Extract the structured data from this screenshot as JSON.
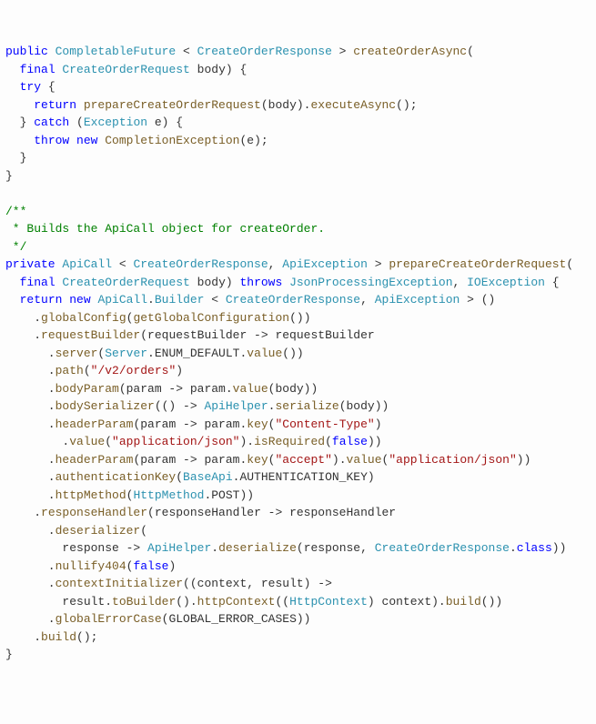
{
  "code": {
    "tokens": [
      {
        "t": "public ",
        "c": "kw"
      },
      {
        "t": "CompletableFuture",
        "c": "type"
      },
      {
        "t": " < ",
        "c": "pl"
      },
      {
        "t": "CreateOrderResponse",
        "c": "type"
      },
      {
        "t": " > ",
        "c": "pl"
      },
      {
        "t": "createOrderAsync",
        "c": "method"
      },
      {
        "t": "(",
        "c": "pl"
      },
      {
        "t": "\n",
        "c": "pl"
      },
      {
        "t": "  ",
        "c": "pl"
      },
      {
        "t": "final ",
        "c": "kw"
      },
      {
        "t": "CreateOrderRequest",
        "c": "type"
      },
      {
        "t": " body) {",
        "c": "pl"
      },
      {
        "t": "\n",
        "c": "pl"
      },
      {
        "t": "  ",
        "c": "pl"
      },
      {
        "t": "try",
        "c": "kw"
      },
      {
        "t": " {",
        "c": "pl"
      },
      {
        "t": "\n",
        "c": "pl"
      },
      {
        "t": "    ",
        "c": "pl"
      },
      {
        "t": "return ",
        "c": "kw"
      },
      {
        "t": "prepareCreateOrderRequest",
        "c": "method"
      },
      {
        "t": "(body).",
        "c": "pl"
      },
      {
        "t": "executeAsync",
        "c": "method"
      },
      {
        "t": "();",
        "c": "pl"
      },
      {
        "t": "\n",
        "c": "pl"
      },
      {
        "t": "  } ",
        "c": "pl"
      },
      {
        "t": "catch",
        "c": "kw"
      },
      {
        "t": " (",
        "c": "pl"
      },
      {
        "t": "Exception",
        "c": "type"
      },
      {
        "t": " e) {",
        "c": "pl"
      },
      {
        "t": "\n",
        "c": "pl"
      },
      {
        "t": "    ",
        "c": "pl"
      },
      {
        "t": "throw new ",
        "c": "kw"
      },
      {
        "t": "CompletionException",
        "c": "method"
      },
      {
        "t": "(e);",
        "c": "pl"
      },
      {
        "t": "\n",
        "c": "pl"
      },
      {
        "t": "  }",
        "c": "pl"
      },
      {
        "t": "\n",
        "c": "pl"
      },
      {
        "t": "}",
        "c": "pl"
      },
      {
        "t": "\n",
        "c": "pl"
      },
      {
        "t": "\n",
        "c": "pl"
      },
      {
        "t": "/**",
        "c": "comment"
      },
      {
        "t": "\n",
        "c": "pl"
      },
      {
        "t": " * Builds the ApiCall object for createOrder.",
        "c": "comment"
      },
      {
        "t": "\n",
        "c": "pl"
      },
      {
        "t": " */",
        "c": "comment"
      },
      {
        "t": "\n",
        "c": "pl"
      },
      {
        "t": "private ",
        "c": "kw"
      },
      {
        "t": "ApiCall",
        "c": "type"
      },
      {
        "t": " < ",
        "c": "pl"
      },
      {
        "t": "CreateOrderResponse",
        "c": "type"
      },
      {
        "t": ", ",
        "c": "pl"
      },
      {
        "t": "ApiException",
        "c": "type"
      },
      {
        "t": " > ",
        "c": "pl"
      },
      {
        "t": "prepareCreateOrderRequest",
        "c": "method"
      },
      {
        "t": "(",
        "c": "pl"
      },
      {
        "t": "\n",
        "c": "pl"
      },
      {
        "t": "  ",
        "c": "pl"
      },
      {
        "t": "final ",
        "c": "kw"
      },
      {
        "t": "CreateOrderRequest",
        "c": "type"
      },
      {
        "t": " body) ",
        "c": "pl"
      },
      {
        "t": "throws ",
        "c": "kw"
      },
      {
        "t": "JsonProcessingException",
        "c": "type"
      },
      {
        "t": ", ",
        "c": "pl"
      },
      {
        "t": "IOException",
        "c": "type"
      },
      {
        "t": " {",
        "c": "pl"
      },
      {
        "t": "\n",
        "c": "pl"
      },
      {
        "t": "  ",
        "c": "pl"
      },
      {
        "t": "return new ",
        "c": "kw"
      },
      {
        "t": "ApiCall",
        "c": "type"
      },
      {
        "t": ".",
        "c": "pl"
      },
      {
        "t": "Builder",
        "c": "type"
      },
      {
        "t": " < ",
        "c": "pl"
      },
      {
        "t": "CreateOrderResponse",
        "c": "type"
      },
      {
        "t": ", ",
        "c": "pl"
      },
      {
        "t": "ApiException",
        "c": "type"
      },
      {
        "t": " > ()",
        "c": "pl"
      },
      {
        "t": "\n",
        "c": "pl"
      },
      {
        "t": "    .",
        "c": "pl"
      },
      {
        "t": "globalConfig",
        "c": "method"
      },
      {
        "t": "(",
        "c": "pl"
      },
      {
        "t": "getGlobalConfiguration",
        "c": "method"
      },
      {
        "t": "())",
        "c": "pl"
      },
      {
        "t": "\n",
        "c": "pl"
      },
      {
        "t": "    .",
        "c": "pl"
      },
      {
        "t": "requestBuilder",
        "c": "method"
      },
      {
        "t": "(requestBuilder -> requestBuilder",
        "c": "pl"
      },
      {
        "t": "\n",
        "c": "pl"
      },
      {
        "t": "      .",
        "c": "pl"
      },
      {
        "t": "server",
        "c": "method"
      },
      {
        "t": "(",
        "c": "pl"
      },
      {
        "t": "Server",
        "c": "type"
      },
      {
        "t": ".ENUM_DEFAULT.",
        "c": "pl"
      },
      {
        "t": "value",
        "c": "method"
      },
      {
        "t": "())",
        "c": "pl"
      },
      {
        "t": "\n",
        "c": "pl"
      },
      {
        "t": "      .",
        "c": "pl"
      },
      {
        "t": "path",
        "c": "method"
      },
      {
        "t": "(",
        "c": "pl"
      },
      {
        "t": "\"/v2/orders\"",
        "c": "str"
      },
      {
        "t": ")",
        "c": "pl"
      },
      {
        "t": "\n",
        "c": "pl"
      },
      {
        "t": "      .",
        "c": "pl"
      },
      {
        "t": "bodyParam",
        "c": "method"
      },
      {
        "t": "(param -> param.",
        "c": "pl"
      },
      {
        "t": "value",
        "c": "method"
      },
      {
        "t": "(body))",
        "c": "pl"
      },
      {
        "t": "\n",
        "c": "pl"
      },
      {
        "t": "      .",
        "c": "pl"
      },
      {
        "t": "bodySerializer",
        "c": "method"
      },
      {
        "t": "(() -> ",
        "c": "pl"
      },
      {
        "t": "ApiHelper",
        "c": "type"
      },
      {
        "t": ".",
        "c": "pl"
      },
      {
        "t": "serialize",
        "c": "method"
      },
      {
        "t": "(body))",
        "c": "pl"
      },
      {
        "t": "\n",
        "c": "pl"
      },
      {
        "t": "      .",
        "c": "pl"
      },
      {
        "t": "headerParam",
        "c": "method"
      },
      {
        "t": "(param -> param.",
        "c": "pl"
      },
      {
        "t": "key",
        "c": "method"
      },
      {
        "t": "(",
        "c": "pl"
      },
      {
        "t": "\"Content-Type\"",
        "c": "str"
      },
      {
        "t": ")",
        "c": "pl"
      },
      {
        "t": "\n",
        "c": "pl"
      },
      {
        "t": "        .",
        "c": "pl"
      },
      {
        "t": "value",
        "c": "method"
      },
      {
        "t": "(",
        "c": "pl"
      },
      {
        "t": "\"application/json\"",
        "c": "str"
      },
      {
        "t": ").",
        "c": "pl"
      },
      {
        "t": "isRequired",
        "c": "method"
      },
      {
        "t": "(",
        "c": "pl"
      },
      {
        "t": "false",
        "c": "kw"
      },
      {
        "t": "))",
        "c": "pl"
      },
      {
        "t": "\n",
        "c": "pl"
      },
      {
        "t": "      .",
        "c": "pl"
      },
      {
        "t": "headerParam",
        "c": "method"
      },
      {
        "t": "(param -> param.",
        "c": "pl"
      },
      {
        "t": "key",
        "c": "method"
      },
      {
        "t": "(",
        "c": "pl"
      },
      {
        "t": "\"accept\"",
        "c": "str"
      },
      {
        "t": ").",
        "c": "pl"
      },
      {
        "t": "value",
        "c": "method"
      },
      {
        "t": "(",
        "c": "pl"
      },
      {
        "t": "\"application/json\"",
        "c": "str"
      },
      {
        "t": "))",
        "c": "pl"
      },
      {
        "t": "\n",
        "c": "pl"
      },
      {
        "t": "      .",
        "c": "pl"
      },
      {
        "t": "authenticationKey",
        "c": "method"
      },
      {
        "t": "(",
        "c": "pl"
      },
      {
        "t": "BaseApi",
        "c": "type"
      },
      {
        "t": ".AUTHENTICATION_KEY)",
        "c": "pl"
      },
      {
        "t": "\n",
        "c": "pl"
      },
      {
        "t": "      .",
        "c": "pl"
      },
      {
        "t": "httpMethod",
        "c": "method"
      },
      {
        "t": "(",
        "c": "pl"
      },
      {
        "t": "HttpMethod",
        "c": "type"
      },
      {
        "t": ".POST))",
        "c": "pl"
      },
      {
        "t": "\n",
        "c": "pl"
      },
      {
        "t": "    .",
        "c": "pl"
      },
      {
        "t": "responseHandler",
        "c": "method"
      },
      {
        "t": "(responseHandler -> responseHandler",
        "c": "pl"
      },
      {
        "t": "\n",
        "c": "pl"
      },
      {
        "t": "      .",
        "c": "pl"
      },
      {
        "t": "deserializer",
        "c": "method"
      },
      {
        "t": "(",
        "c": "pl"
      },
      {
        "t": "\n",
        "c": "pl"
      },
      {
        "t": "        response -> ",
        "c": "pl"
      },
      {
        "t": "ApiHelper",
        "c": "type"
      },
      {
        "t": ".",
        "c": "pl"
      },
      {
        "t": "deserialize",
        "c": "method"
      },
      {
        "t": "(response, ",
        "c": "pl"
      },
      {
        "t": "CreateOrderResponse",
        "c": "type"
      },
      {
        "t": ".",
        "c": "pl"
      },
      {
        "t": "class",
        "c": "kw"
      },
      {
        "t": "))",
        "c": "pl"
      },
      {
        "t": "\n",
        "c": "pl"
      },
      {
        "t": "      .",
        "c": "pl"
      },
      {
        "t": "nullify404",
        "c": "method"
      },
      {
        "t": "(",
        "c": "pl"
      },
      {
        "t": "false",
        "c": "kw"
      },
      {
        "t": ")",
        "c": "pl"
      },
      {
        "t": "\n",
        "c": "pl"
      },
      {
        "t": "      .",
        "c": "pl"
      },
      {
        "t": "contextInitializer",
        "c": "method"
      },
      {
        "t": "((context, result) ->",
        "c": "pl"
      },
      {
        "t": "\n",
        "c": "pl"
      },
      {
        "t": "        result.",
        "c": "pl"
      },
      {
        "t": "toBuilder",
        "c": "method"
      },
      {
        "t": "().",
        "c": "pl"
      },
      {
        "t": "httpContext",
        "c": "method"
      },
      {
        "t": "((",
        "c": "pl"
      },
      {
        "t": "HttpContext",
        "c": "type"
      },
      {
        "t": ") context).",
        "c": "pl"
      },
      {
        "t": "build",
        "c": "method"
      },
      {
        "t": "())",
        "c": "pl"
      },
      {
        "t": "\n",
        "c": "pl"
      },
      {
        "t": "      .",
        "c": "pl"
      },
      {
        "t": "globalErrorCase",
        "c": "method"
      },
      {
        "t": "(GLOBAL_ERROR_CASES))",
        "c": "pl"
      },
      {
        "t": "\n",
        "c": "pl"
      },
      {
        "t": "    .",
        "c": "pl"
      },
      {
        "t": "build",
        "c": "method"
      },
      {
        "t": "();",
        "c": "pl"
      },
      {
        "t": "\n",
        "c": "pl"
      },
      {
        "t": "}",
        "c": "pl"
      }
    ]
  }
}
